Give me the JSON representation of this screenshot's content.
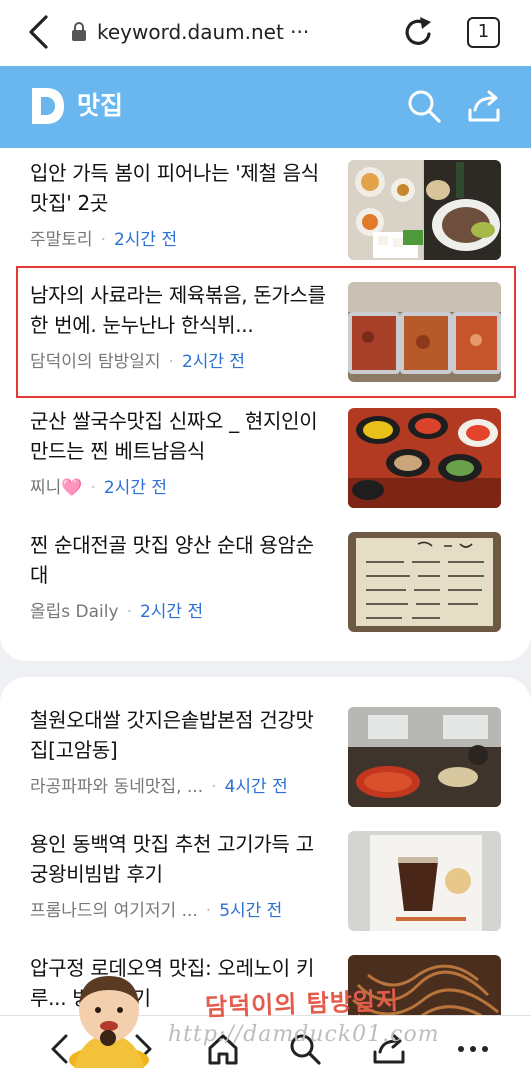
{
  "browser": {
    "url": "keyword.daum.net ···",
    "tab_count": "1"
  },
  "header": {
    "logo": "D",
    "title": "맛집"
  },
  "section1": {
    "items": [
      {
        "title": "입안 가득 봄이 피어나는 '제철 음식 맛집' 2곳",
        "source": "주말토리",
        "time": "2시간 전",
        "thumb": "seasonal-food-plates"
      },
      {
        "title": "남자의 사료라는 제육볶음, 돈가스를 한 번에. 눈누난나 한식뷔...",
        "source": "담덕이의 탐방일지",
        "time": "2시간 전",
        "thumb": "buffet-trays"
      },
      {
        "title": "군산 쌀국수맛집 신짜오 _ 현지인이 만드는 찐 베트남음식",
        "source": "찌니🩷",
        "time": "2시간 전",
        "thumb": "vietnamese-side-dishes"
      },
      {
        "title": "찐 순대전골 맛집 양산 순대 용암순대",
        "source": "올립s Daily",
        "time": "2시간 전",
        "thumb": "handwritten-menu-board"
      }
    ]
  },
  "section2": {
    "items": [
      {
        "title": "철원오대쌀 갓지은솥밥본점 건강맛집[고암동]",
        "source": "라공파파와 동네맛집, ...",
        "time": "4시간 전",
        "thumb": "restaurant-interior"
      },
      {
        "title": "용인 동백역 맛집 추천 고기가득 고궁왕비빔밥 후기",
        "source": "프롬나드의 여기저기 ...",
        "time": "5시간 전",
        "thumb": "iced-americano-sign"
      },
      {
        "title": "압구정 로데오역 맛집: 오레노이 키루... 방문 후기",
        "source": "",
        "time": "",
        "thumb": "noodles"
      }
    ]
  },
  "watermark": {
    "name": "담덕이의 탐방일지",
    "url": "http://damduck01.com"
  },
  "colors": {
    "header_bg": "#6ab7f0",
    "time_blue": "#2c6fd6",
    "highlight_red": "#e53935"
  }
}
